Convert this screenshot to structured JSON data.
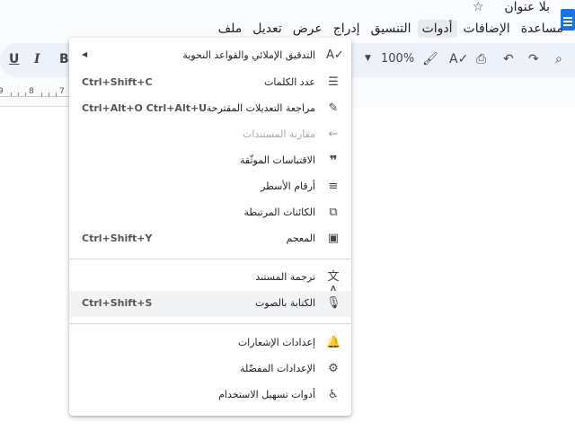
{
  "header": {
    "title": "بلا عنوان"
  },
  "menubar": {
    "items": [
      "ملف",
      "تعديل",
      "عرض",
      "إدراج",
      "التنسيق",
      "أدوات",
      "الإضافات",
      "مساعدة"
    ],
    "active_index": 5
  },
  "toolbar": {
    "zoom": "100%",
    "bold": "B",
    "italic": "I",
    "underline": "U"
  },
  "ruler": {
    "numbers": [
      "9",
      "8",
      "7"
    ]
  },
  "tools_menu": {
    "items": [
      {
        "label": "التدقيق الإملائي والقواعد النحوية",
        "shortcut": "",
        "icon": "spellcheck-icon",
        "submenu": true
      },
      {
        "label": "عدد الكلمات",
        "shortcut": "Ctrl+Shift+C",
        "icon": "word-count-icon"
      },
      {
        "label": "مراجعة التعديلات المقترحة",
        "shortcut": "Ctrl+Alt+O Ctrl+Alt+U",
        "icon": "review-edits-icon"
      },
      {
        "label": "مقارنة المستندات",
        "shortcut": "",
        "icon": "compare-icon",
        "disabled": true
      },
      {
        "label": "الاقتباسات الموثّقة",
        "shortcut": "",
        "icon": "quote-icon"
      },
      {
        "label": "أرقام الأسطر",
        "shortcut": "",
        "icon": "line-numbers-icon"
      },
      {
        "label": "الكائنات المرتبطة",
        "shortcut": "",
        "icon": "linked-objects-icon"
      },
      {
        "label": "المعجم",
        "shortcut": "Ctrl+Shift+Y",
        "icon": "dictionary-icon"
      },
      {
        "label": "ترجمة المستند",
        "shortcut": "",
        "icon": "translate-icon"
      },
      {
        "label": "الكتابة بالصوت",
        "shortcut": "Ctrl+Shift+S",
        "icon": "microphone-icon"
      },
      {
        "label": "إعدادات الإشعارات",
        "shortcut": "",
        "icon": "bell-icon"
      },
      {
        "label": "الإعدادات المفضّلة",
        "shortcut": "",
        "icon": "preferences-icon"
      },
      {
        "label": "أدوات تسهيل الاستخدام",
        "shortcut": "",
        "icon": "accessibility-icon"
      }
    ]
  }
}
